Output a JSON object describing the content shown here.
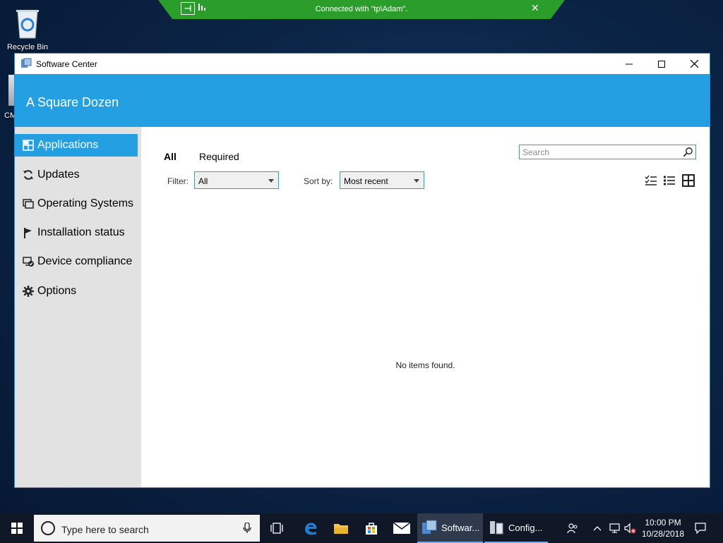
{
  "desktop": {
    "recycle_bin_label": "Recycle Bin",
    "cm_label": "CM"
  },
  "rdp_bar": {
    "connection_text": "Connected with \"tp\\Adam\".",
    "close_symbol": "✕"
  },
  "window": {
    "title": "Software Center",
    "org_name": "A Square Dozen",
    "nav": {
      "items": [
        {
          "label": "Applications",
          "icon": "applications-icon",
          "active": true
        },
        {
          "label": "Updates",
          "icon": "updates-icon"
        },
        {
          "label": "Operating Systems",
          "icon": "operating-systems-icon"
        },
        {
          "label": "Installation status",
          "icon": "flag-icon"
        },
        {
          "label": "Device compliance",
          "icon": "device-compliance-icon"
        },
        {
          "label": "Options",
          "icon": "gear-icon"
        }
      ]
    },
    "main": {
      "tabs": [
        {
          "label": "All",
          "selected": true
        },
        {
          "label": "Required",
          "selected": false
        }
      ],
      "search_placeholder": "Search",
      "filter_label": "Filter:",
      "filter_value": "All",
      "sort_label": "Sort by:",
      "sort_value": "Most recent",
      "empty_message": "No items found."
    }
  },
  "taskbar": {
    "search_placeholder": "Type here to search",
    "apps": [
      {
        "label": "Softwar...",
        "icon": "software-center-icon",
        "active": true
      },
      {
        "label": "Config...",
        "icon": "config-manager-icon",
        "active": false
      }
    ],
    "clock": {
      "time": "10:00 PM",
      "date": "10/28/2018"
    }
  },
  "colors": {
    "accent": "#24a0e2",
    "sidebar": "#e3e2e2",
    "rdp_green": "#2a9d2a",
    "taskbar": "#101828"
  }
}
